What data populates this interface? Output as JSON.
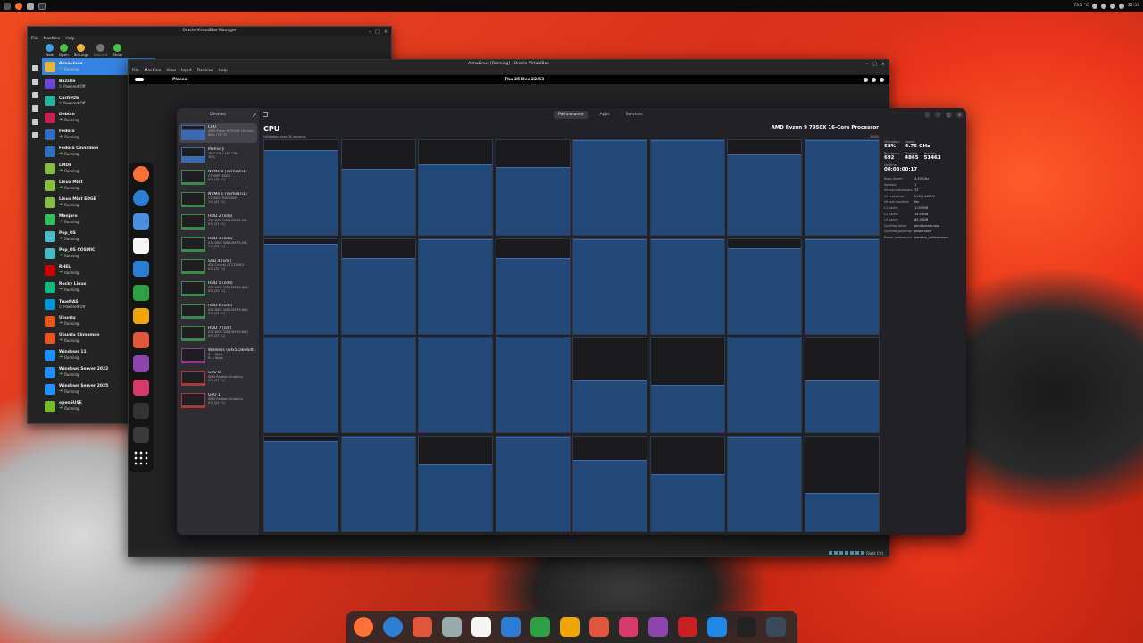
{
  "topbar": {
    "temp": "73.5 °C",
    "time": "22:53"
  },
  "vbox_manager": {
    "title": "Oracle VirtualBox Manager",
    "menu": [
      "File",
      "Machine",
      "Help"
    ],
    "toolbar": [
      "New",
      "Open",
      "Settings",
      "Discard",
      "Show"
    ],
    "vms": [
      {
        "name": "AlmaLinux",
        "state": "Running",
        "running": true,
        "color": "#e8b73a"
      },
      {
        "name": "Bazzite",
        "state": "Powered Off",
        "running": false,
        "color": "#6c4ad0"
      },
      {
        "name": "CachyOS",
        "state": "Powered Off",
        "running": false,
        "color": "#2fb09b"
      },
      {
        "name": "Debian",
        "state": "Running",
        "running": true,
        "color": "#c72050"
      },
      {
        "name": "Fedora",
        "state": "Running",
        "running": true,
        "color": "#2f6fbf"
      },
      {
        "name": "Fedora Cinnamon",
        "state": "Running",
        "running": true,
        "color": "#2f6fbf"
      },
      {
        "name": "LMDE",
        "state": "Running",
        "running": true,
        "color": "#86be43"
      },
      {
        "name": "Linux Mint",
        "state": "Running",
        "running": true,
        "color": "#86be43"
      },
      {
        "name": "Linux Mint EDGE",
        "state": "Running",
        "running": true,
        "color": "#86be43"
      },
      {
        "name": "Manjaro",
        "state": "Running",
        "running": true,
        "color": "#35bf5c"
      },
      {
        "name": "Pop_OS",
        "state": "Running",
        "running": true,
        "color": "#48b9c7"
      },
      {
        "name": "Pop_OS COSMIC",
        "state": "Running",
        "running": true,
        "color": "#48b9c7"
      },
      {
        "name": "RHEL",
        "state": "Running",
        "running": true,
        "color": "#cc0000"
      },
      {
        "name": "Rocky Linux",
        "state": "Running",
        "running": true,
        "color": "#10b981"
      },
      {
        "name": "TrueNAS",
        "state": "Powered Off",
        "running": false,
        "color": "#0095d5"
      },
      {
        "name": "Ubuntu",
        "state": "Running",
        "running": true,
        "color": "#e95420"
      },
      {
        "name": "Ubuntu Cinnamon",
        "state": "Running",
        "running": true,
        "color": "#e95420"
      },
      {
        "name": "Windows 11",
        "state": "Running",
        "running": true,
        "color": "#1e90ff"
      },
      {
        "name": "Windows Server 2022",
        "state": "Running",
        "running": true,
        "color": "#1e90ff"
      },
      {
        "name": "Windows Server 2025",
        "state": "Running",
        "running": true,
        "color": "#1e90ff"
      },
      {
        "name": "openSUSE",
        "state": "Running",
        "running": true,
        "color": "#73ba25"
      }
    ]
  },
  "vm_window": {
    "title": "AlmaLinux [Running] - Oracle VirtualBox",
    "menu": [
      "File",
      "Machine",
      "View",
      "Input",
      "Devices",
      "Help"
    ],
    "status_key": "Right Ctrl"
  },
  "guest": {
    "places": "Places",
    "clock": "Thu 25 Dec  22:53"
  },
  "resources": {
    "devices_title": "Devices",
    "tabs": [
      "Performance",
      "Apps",
      "Services"
    ],
    "devices": [
      {
        "name": "CPU",
        "sub": "AMD Ryzen 9 7950X 16-Core...",
        "sub2": "68% (71 °C)",
        "color": "#3a6ab0"
      },
      {
        "name": "Memory",
        "sub": "18.4 GiB / 188 GiB",
        "sub2": "10%",
        "color": "#3a6ab0"
      },
      {
        "name": "NVMe 0 (nvme0n1)",
        "sub": "CT500P1SSD8",
        "sub2": "0% (45 °C)",
        "color": "#3a8a4a"
      },
      {
        "name": "NVMe 1 (nvme1n1)",
        "sub": "CT2000T500SSD8",
        "sub2": "1% (43 °C)",
        "color": "#3a8a4a"
      },
      {
        "name": "HDD 2 (sda)",
        "sub": "ATA WDC WD40EFPX-68C",
        "sub2": "0% (31 °C)",
        "color": "#3a8a4a"
      },
      {
        "name": "HDD 3 (sdb)",
        "sub": "ATA WDC WD40EFPX-68C",
        "sub2": "0% (32 °C)",
        "color": "#3a8a4a"
      },
      {
        "name": "SSD 4 (sdc)",
        "sub": "ATA Crucial_CT275MX3",
        "sub2": "0% (32 °C)",
        "color": "#3a8a4a"
      },
      {
        "name": "HDD 5 (sdd)",
        "sub": "ATA WDC WD20EFRX-68A",
        "sub2": "0% (30 °C)",
        "color": "#3a8a4a"
      },
      {
        "name": "HDD 6 (sde)",
        "sub": "ATA WDC WD20EFRX-68A",
        "sub2": "0% (32 °C)",
        "color": "#3a8a4a"
      },
      {
        "name": "HDD 7 (sdf)",
        "sub": "ATA WDC WD40EFRX-68H",
        "sub2": "0% (33 °C)",
        "color": "#3a8a4a"
      },
      {
        "name": "Wireless (wlx5ca6e6df...",
        "sub": "S: 1 Kbps",
        "sub2": "R: 2 Kbps",
        "color": "#8a3a8a"
      },
      {
        "name": "GPU 0",
        "sub": "AMD Radeon Graphics",
        "sub2": "0% (47 °C)",
        "color": "#a83a3a"
      },
      {
        "name": "GPU 1",
        "sub": "AMD Radeon Graphics",
        "sub2": "0% (54 °C)",
        "color": "#a83a3a"
      }
    ],
    "cpu_title": "CPU",
    "cpu_model": "AMD Ryzen 9 7950X 16-Core Processor",
    "util_note": "Utilization over 30 seconds",
    "util_max": "100%",
    "core_util": [
      90,
      70,
      75,
      72,
      100,
      100,
      85,
      100,
      95,
      80,
      100,
      80,
      100,
      100,
      90,
      100,
      100,
      100,
      100,
      100,
      55,
      50,
      100,
      55,
      95,
      100,
      70,
      100,
      75,
      60,
      100,
      40
    ],
    "stats": {
      "utilization_label": "Utilization",
      "utilization": "68%",
      "speed_label": "Speed",
      "speed": "4.76 GHz",
      "processes_label": "Processes",
      "processes": "692",
      "threads_label": "Threads",
      "threads": "4865",
      "handles_label": "Handles",
      "handles": "51463",
      "uptime_label": "Up time",
      "uptime": "00:03:00:17"
    },
    "details": [
      {
        "k": "Base Speed",
        "v": "4.50 GHz"
      },
      {
        "k": "Sockets",
        "v": "1"
      },
      {
        "k": "Virtual processors",
        "v": "32"
      },
      {
        "k": "Virtualization",
        "v": "KVM / AMD-V"
      },
      {
        "k": "Virtual machine",
        "v": "No"
      },
      {
        "k": "L1 cache",
        "v": "1.00 MiB"
      },
      {
        "k": "L2 cache",
        "v": "16.0 MiB"
      },
      {
        "k": "L3 cache",
        "v": "64.0 MiB"
      },
      {
        "k": "CpuFreq driver",
        "v": "amd-pstate-epp"
      },
      {
        "k": "CpuFreq governor",
        "v": "powersave"
      },
      {
        "k": "Power preference",
        "v": "balance_performance"
      }
    ]
  },
  "dock_apps": [
    {
      "name": "firefox",
      "color": "#ff7139"
    },
    {
      "name": "thunderbird",
      "color": "#2d7fd3"
    },
    {
      "name": "files",
      "color": "#4a8fe0"
    },
    {
      "name": "text-editor",
      "color": "#f5f5f5"
    },
    {
      "name": "writer",
      "color": "#2b7cd3"
    },
    {
      "name": "calc",
      "color": "#2ea043"
    },
    {
      "name": "impress",
      "color": "#f0a500"
    },
    {
      "name": "draw",
      "color": "#e0563b"
    },
    {
      "name": "base",
      "color": "#8e44ad"
    },
    {
      "name": "math",
      "color": "#d63a6a"
    },
    {
      "name": "terminal",
      "color": "#333333"
    },
    {
      "name": "resources",
      "color": "#3a3a3a"
    },
    {
      "name": "app-grid",
      "color": "#141414"
    }
  ],
  "bottom_dock_apps": [
    {
      "name": "firefox",
      "color": "#ff7139"
    },
    {
      "name": "thunderbird",
      "color": "#2d7fd3"
    },
    {
      "name": "davinci",
      "color": "#e0563b"
    },
    {
      "name": "files",
      "color": "#9aa"
    },
    {
      "name": "text-editor",
      "color": "#f5f5f5"
    },
    {
      "name": "writer",
      "color": "#2b7cd3"
    },
    {
      "name": "calc",
      "color": "#2ea043"
    },
    {
      "name": "impress",
      "color": "#f0a500"
    },
    {
      "name": "draw",
      "color": "#e0563b"
    },
    {
      "name": "math",
      "color": "#d63a6a"
    },
    {
      "name": "base",
      "color": "#8e44ad"
    },
    {
      "name": "filezilla",
      "color": "#c72020"
    },
    {
      "name": "waveform",
      "color": "#1e88e5"
    },
    {
      "name": "terminal",
      "color": "#222222"
    },
    {
      "name": "resources",
      "color": "#3a4a5a"
    }
  ]
}
